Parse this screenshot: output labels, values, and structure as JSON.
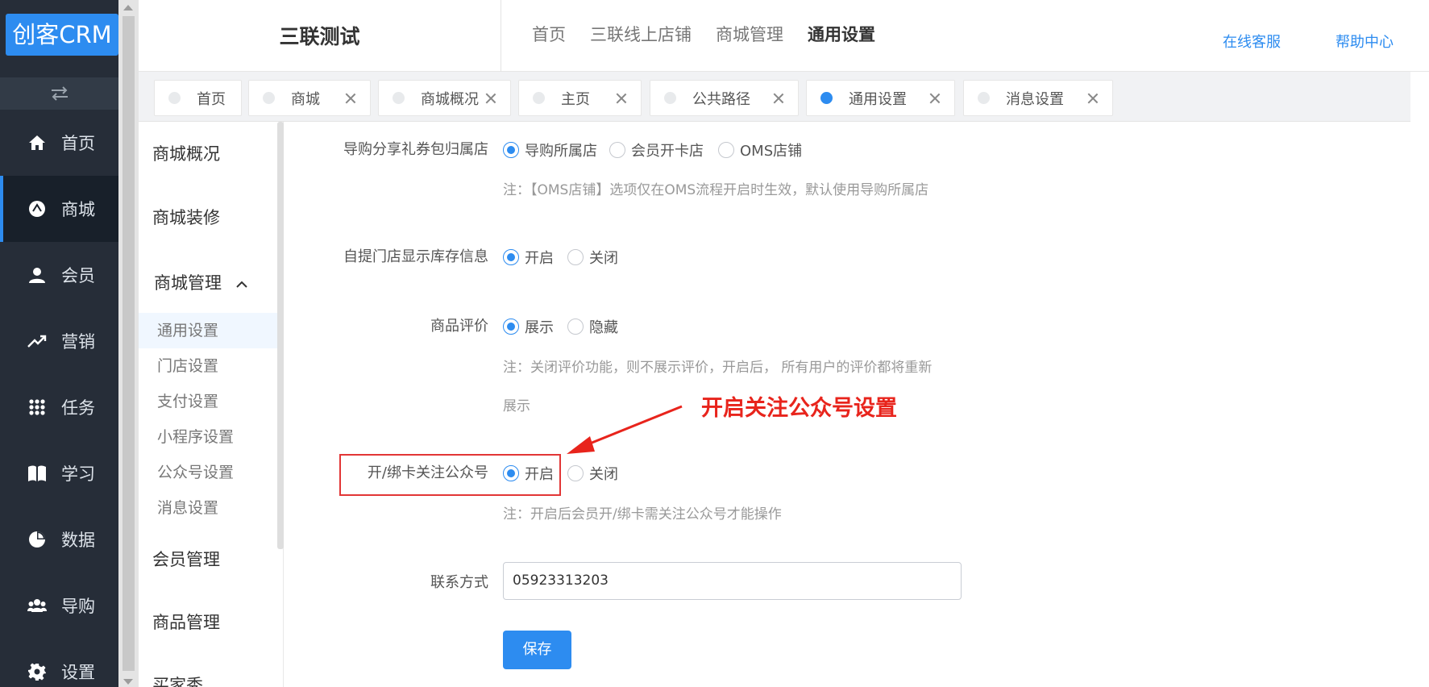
{
  "logo": {
    "text": "创客CRM"
  },
  "sidebar": {
    "items": [
      {
        "label": "首页",
        "icon": "home-icon"
      },
      {
        "label": "商城",
        "icon": "mall-icon",
        "active": true
      },
      {
        "label": "会员",
        "icon": "user-icon"
      },
      {
        "label": "营销",
        "icon": "trend-icon"
      },
      {
        "label": "任务",
        "icon": "grid-icon"
      },
      {
        "label": "学习",
        "icon": "book-icon"
      },
      {
        "label": "数据",
        "icon": "pie-icon"
      },
      {
        "label": "导购",
        "icon": "group-icon"
      },
      {
        "label": "设置",
        "icon": "gear-icon"
      }
    ]
  },
  "header": {
    "store_name": "三联测试",
    "nav": [
      "首页",
      "三联线上店铺",
      "商城管理",
      "通用设置"
    ],
    "nav_current": "通用设置",
    "online_service": "在线客服",
    "help_center": "帮助中心"
  },
  "tabs": [
    {
      "label": "首页",
      "active": false,
      "closable": false
    },
    {
      "label": "商城",
      "active": false,
      "closable": true
    },
    {
      "label": "商城概况",
      "active": false,
      "closable": true
    },
    {
      "label": "主页",
      "active": false,
      "closable": true
    },
    {
      "label": "公共路径",
      "active": false,
      "closable": true
    },
    {
      "label": "通用设置",
      "active": true,
      "closable": true
    },
    {
      "label": "消息设置",
      "active": false,
      "closable": true
    }
  ],
  "submenu": {
    "groups": {
      "overview": "商城概况",
      "decoration": "商城装修",
      "management": "商城管理",
      "member": "会员管理",
      "product": "商品管理",
      "cut": "买家秀"
    },
    "items": [
      "通用设置",
      "门店设置",
      "支付设置",
      "小程序设置",
      "公众号设置",
      "消息设置"
    ],
    "current": "通用设置"
  },
  "form": {
    "coupon_owner": {
      "label": "导购分享礼券包归属店",
      "options": [
        "导购所属店",
        "会员开卡店",
        "OMS店铺"
      ],
      "selected": "导购所属店",
      "note": "注：【OMS店铺】选项仅在OMS流程开启时生效，默认使用导购所属店"
    },
    "stock_info": {
      "label": "自提门店显示库存信息",
      "options": [
        "开启",
        "关闭"
      ],
      "selected": "开启"
    },
    "review": {
      "label": "商品评价",
      "options": [
        "展示",
        "隐藏"
      ],
      "selected": "展示",
      "note_line1": "注：关闭评价功能，则不展示评价，开启后， 所有用户的评价都将重新",
      "note_line2": "展示"
    },
    "follow_oa": {
      "label": "开/绑卡关注公众号",
      "options": [
        "开启",
        "关闭"
      ],
      "selected": "开启",
      "note": "注：开启后会员开/绑卡需关注公众号才能操作"
    },
    "contact": {
      "label": "联系方式",
      "value": "05923313203"
    },
    "save_label": "保存"
  },
  "annotation": {
    "text": "开启关注公众号设置",
    "color": "#e8241c"
  },
  "colors": {
    "accent": "#2d8cf0",
    "sidebar": "#262d38"
  }
}
